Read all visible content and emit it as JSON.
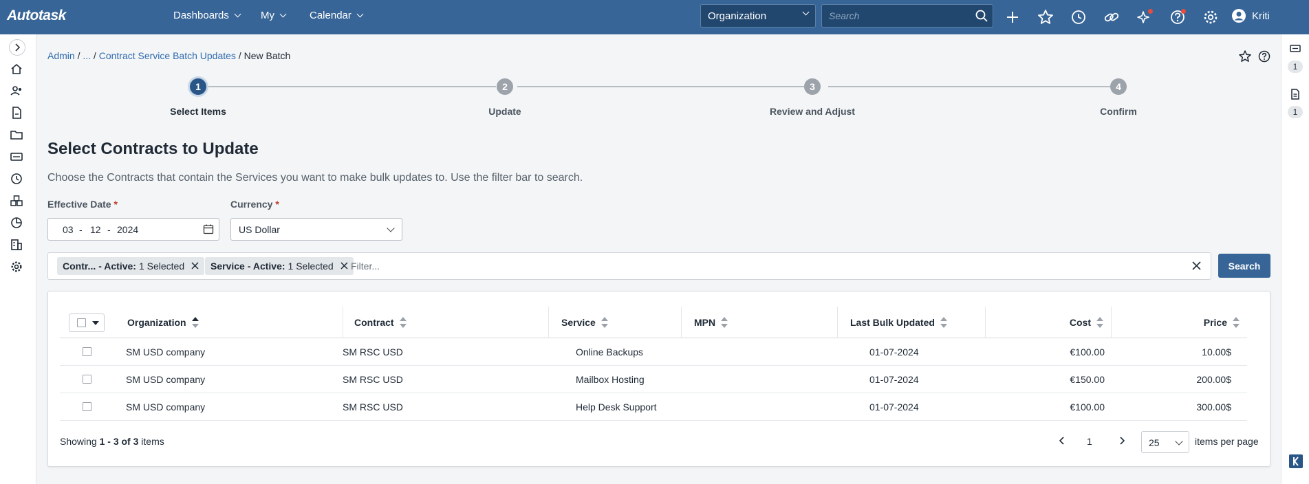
{
  "topbar": {
    "logo": "Autotask",
    "nav": [
      {
        "label": "Dashboards"
      },
      {
        "label": "My"
      },
      {
        "label": "Calendar"
      }
    ],
    "org_select": "Organization",
    "search_placeholder": "Search",
    "user_name": "Kriti",
    "icons": [
      "plus-icon",
      "star-icon",
      "clock-icon",
      "link-icon",
      "sparkle-icon",
      "help-icon",
      "gear-icon",
      "user-avatar-icon"
    ],
    "bg_color": "#376597"
  },
  "leftrail": {
    "icons": [
      "home-icon",
      "contacts-icon",
      "document-icon",
      "folder-icon",
      "ticket-icon",
      "time-icon",
      "inventory-icon",
      "chart-icon",
      "org-building-icon",
      "settings-icon"
    ]
  },
  "rightrail": {
    "items": [
      {
        "icon": "ticket-icon",
        "count": "1"
      },
      {
        "icon": "note-icon",
        "count": "1"
      }
    ]
  },
  "breadcrumb": {
    "admin": "Admin",
    "sep": " / ",
    "ellipsis": "...",
    "parent": "Contract Service Batch Updates",
    "current": "New Batch"
  },
  "stepper": {
    "steps": [
      {
        "num": "1",
        "label": "Select Items"
      },
      {
        "num": "2",
        "label": "Update"
      },
      {
        "num": "3",
        "label": "Review and Adjust"
      },
      {
        "num": "4",
        "label": "Confirm"
      }
    ]
  },
  "page": {
    "title": "Select Contracts to Update",
    "description": "Choose the Contracts that contain the Services you want to make bulk updates to. Use the filter bar to search."
  },
  "form": {
    "effective_date_label": "Effective Date",
    "required": "*",
    "date_month": "03",
    "date_day": "12",
    "date_year": "2024",
    "date_sep": "-",
    "currency_label": "Currency",
    "currency_value": "US Dollar"
  },
  "filters": {
    "chips": [
      {
        "name": "Contr...",
        "rest": " - Active:",
        "value": "1 Selected"
      },
      {
        "name": "Service",
        "rest": " - Active:",
        "value": "1 Selected"
      }
    ],
    "placeholder": "Filter...",
    "search_button": "Search"
  },
  "grid": {
    "columns": [
      "Organization",
      "Contract",
      "Service",
      "MPN",
      "Last Bulk Updated",
      "Cost",
      "Price"
    ],
    "rows": [
      {
        "organization": "SM USD company",
        "contract": "SM RSC USD",
        "service": "Online Backups",
        "mpn": "",
        "last_bulk_updated": "01-07-2024",
        "cost": "€100.00",
        "price": "10.00$"
      },
      {
        "organization": "SM USD company",
        "contract": "SM RSC USD",
        "service": "Mailbox Hosting",
        "mpn": "",
        "last_bulk_updated": "01-07-2024",
        "cost": "€150.00",
        "price": "200.00$"
      },
      {
        "organization": "SM USD company",
        "contract": "SM RSC USD",
        "service": "Help Desk Support",
        "mpn": "",
        "last_bulk_updated": "01-07-2024",
        "cost": "€100.00",
        "price": "300.00$"
      }
    ]
  },
  "pager": {
    "showing": "Showing",
    "range": "1 - 3 of 3",
    "items": "items",
    "current_page": "1",
    "per_page": "25",
    "per_page_label": "items per page"
  }
}
